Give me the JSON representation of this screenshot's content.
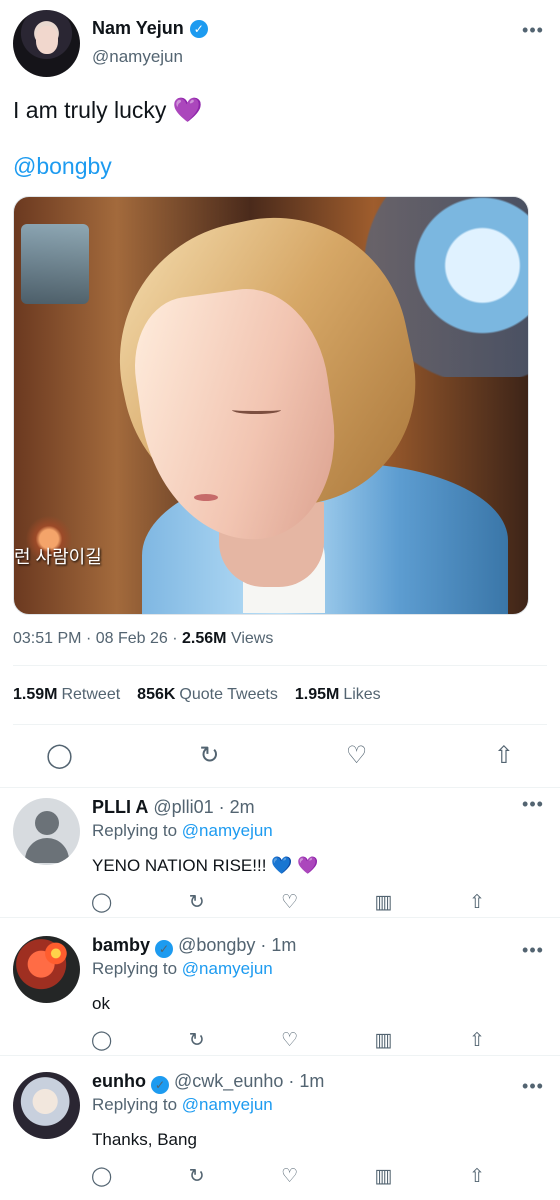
{
  "main_tweet": {
    "display_name": "Nam Yejun",
    "handle": "@namyejun",
    "text": "I am truly lucky",
    "emoji": "💜",
    "mention": "@bongby",
    "image_caption": "런 사람이길",
    "time": "03:51 PM",
    "date": "08 Feb 26",
    "views_count": "2.56M",
    "views_label": "Views",
    "stats": {
      "retweets_count": "1.59M",
      "retweets_label": "Retweet",
      "quotes_count": "856K",
      "quotes_label": "Quote Tweets",
      "likes_count": "1.95M",
      "likes_label": "Likes"
    }
  },
  "replies": [
    {
      "display_name": "PLLI A",
      "handle": "@plli01",
      "time": "2m",
      "replying_label": "Replying to",
      "replying_to": "@namyejun",
      "text": "YENO NATION RISE!!! 💙 💜"
    },
    {
      "display_name": "bamby",
      "handle": "@bongby",
      "time": "1m",
      "replying_label": "Replying to",
      "replying_to": "@namyejun",
      "text": "ok"
    },
    {
      "display_name": "eunho",
      "handle": "@cwk_eunho",
      "time": "1m",
      "replying_label": "Replying to",
      "replying_to": "@namyejun",
      "text": "Thanks, Bang"
    }
  ],
  "icons": {
    "verified": "check-icon",
    "more": "more-icon",
    "reply": "comment-icon",
    "retweet": "retweet-icon",
    "like": "heart-icon",
    "analytics": "bar-chart-icon",
    "share": "share-icon"
  },
  "colors": {
    "accent": "#1d9bf0",
    "text": "#0f1419",
    "secondary_text": "#536471",
    "divider": "#eff3f4",
    "purple_heart": "#a64de8"
  }
}
